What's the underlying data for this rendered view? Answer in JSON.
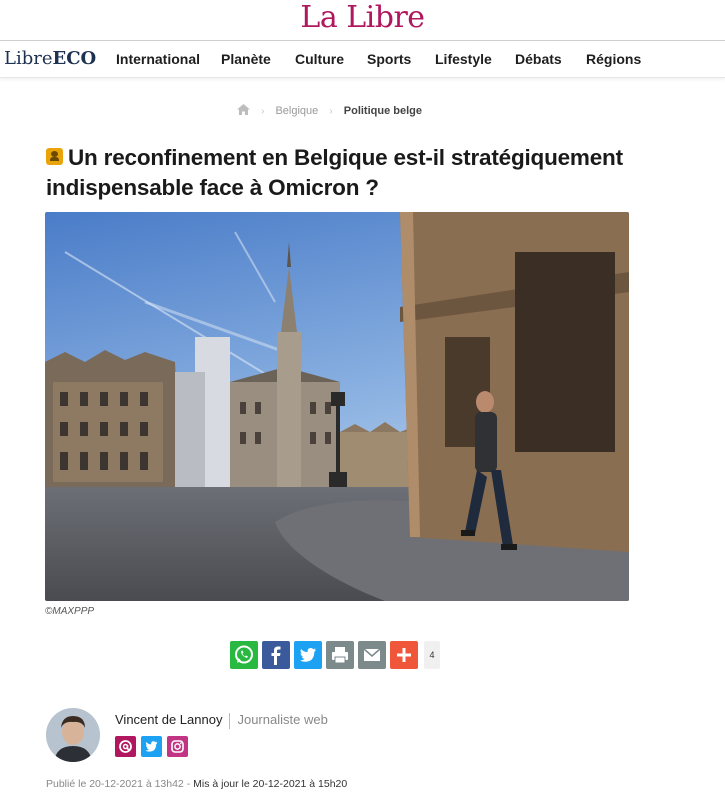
{
  "site": {
    "logo": "La Libre"
  },
  "nav": {
    "brand_prefix": "Libre",
    "brand_suffix": "ECO",
    "items": [
      "International",
      "Planète",
      "Culture",
      "Sports",
      "Lifestyle",
      "Débats",
      "Régions"
    ]
  },
  "breadcrumb": {
    "home_icon": "home-icon",
    "items": [
      "Belgique",
      "Politique belge"
    ]
  },
  "article": {
    "premium_icon": "premium-icon",
    "title": "Un reconfinement en Belgique est-il stratégiquement indispensable face à Omicron ?",
    "photo_credit": "©MAXPPP"
  },
  "share": {
    "buttons": [
      {
        "name": "whatsapp",
        "color": "#2ab940"
      },
      {
        "name": "facebook",
        "color": "#3b5a9b"
      },
      {
        "name": "twitter",
        "color": "#1da1f2"
      },
      {
        "name": "print",
        "color": "#7c8a8c"
      },
      {
        "name": "email",
        "color": "#7c8a8c"
      },
      {
        "name": "more",
        "color": "#f0563a"
      }
    ],
    "count": "4"
  },
  "author": {
    "name": "Vincent de Lannoy",
    "role": "Journaliste web",
    "links": [
      {
        "name": "email",
        "color": "#b1175e"
      },
      {
        "name": "twitter",
        "color": "#1da1f2"
      },
      {
        "name": "instagram",
        "color": "#c13584"
      }
    ]
  },
  "dates": {
    "published": "Publié le 20-12-2021 à 13h42",
    "separator": " - ",
    "updated": "Mis à jour le 20-12-2021 à 15h20"
  }
}
